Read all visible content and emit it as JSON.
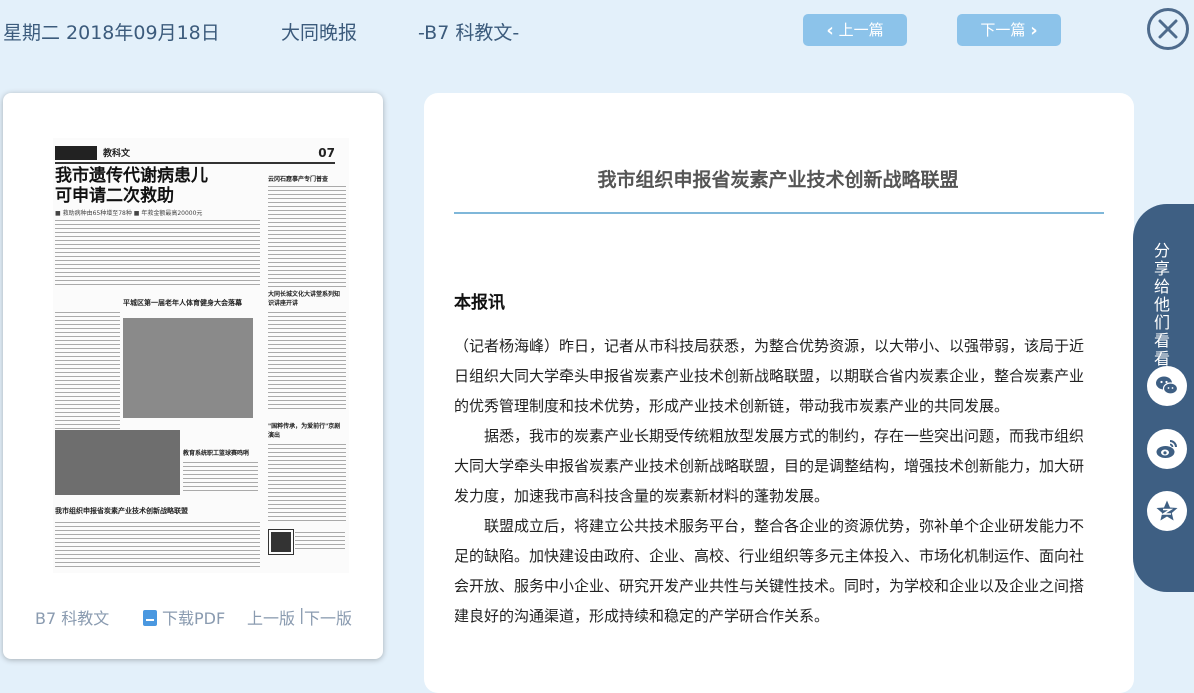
{
  "header": {
    "date": "星期二 2018年09月18日",
    "paper_name": "大同晚报",
    "page_section": "-B7 科教文-",
    "prev_label": "上一篇",
    "next_label": "下一篇",
    "close_icon": "close-icon"
  },
  "thumbnail": {
    "section": "教科文",
    "page_number": "07",
    "headline_line1": "我市遗传代谢病患儿",
    "headline_line2": "可申请二次救助",
    "subline": "■ 救助病种由65种增至78种  ■ 年救金额最高20000元",
    "side_head1": "云冈石窟事产专门普查",
    "box_head1": "平城区第一届老年人体育健身大会落幕",
    "side_head2": "大同长城文化大讲堂系列知识讲座开讲",
    "box_head2": "教育系统职工篮球赛鸣哨",
    "side_head3": "\"国粹传承，为爱前行\"京剧演出",
    "bottom_head": "我市组织申报省炭素产业技术创新战略联盟"
  },
  "card_footer": {
    "section": "B7 科教文",
    "download_label": "下载PDF",
    "prev_page": "上一版",
    "separator": "|",
    "next_page": "下一版",
    "pdf_icon": "pdf-icon"
  },
  "article": {
    "title": "我市组织申报省炭素产业技术创新战略联盟",
    "lead": "本报讯",
    "paragraphs": [
      "（记者杨海峰）昨日，记者从市科技局获悉，为整合优势资源，以大带小、以强带弱，该局于近日组织大同大学牵头申报省炭素产业技术创新战略联盟，以期联合省内炭素企业，整合炭素产业的优秀管理制度和技术优势，形成产业技术创新链，带动我市炭素产业的共同发展。",
      "据悉，我市的炭素产业长期受传统粗放型发展方式的制约，存在一些突出问题，而我市组织大同大学牵头申报省炭素产业技术创新战略联盟，目的是调整结构，增强技术创新能力，加大研发力度，加速我市高科技含量的炭素新材料的蓬勃发展。",
      "联盟成立后，将建立公共技术服务平台，整合各企业的资源优势，弥补单个企业研发能力不足的缺陷。加快建设由政府、企业、高校、行业组织等多元主体投入、市场化机制运作、面向社会开放、服务中小企业、研究开发产业共性与关键性技术。同时，为学校和企业以及企业之间搭建良好的沟通渠道，形成持续和稳定的产学研合作关系。"
    ]
  },
  "share": {
    "label": "分享给他们看看",
    "buttons": [
      "wechat-icon",
      "weibo-icon",
      "qzone-icon"
    ]
  },
  "colors": {
    "background": "#e3f0fa",
    "nav_button": "#8cc3ea",
    "share_tab": "#3e5f83",
    "rule": "#7fb7d9",
    "header_text": "#3c5b7c"
  }
}
